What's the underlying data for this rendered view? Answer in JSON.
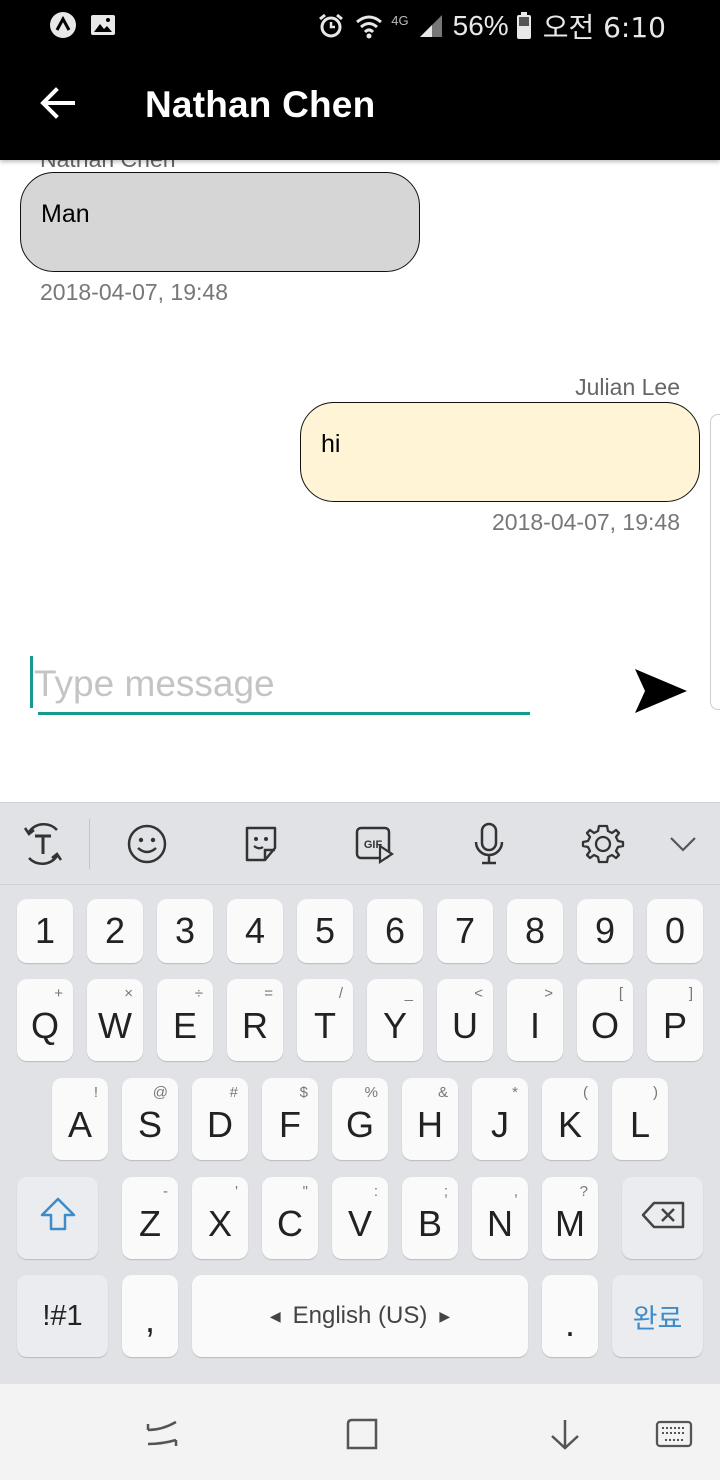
{
  "status_bar": {
    "battery": "56%",
    "time": "오전 6:10",
    "network": "4G",
    "icons": [
      "app-a-icon",
      "gallery-icon",
      "alarm-icon",
      "wifi-icon",
      "signal-icon",
      "battery-icon"
    ]
  },
  "app_bar": {
    "title": "Nathan Chen"
  },
  "messages": [
    {
      "sender": "Nathan Chen",
      "text": "Man",
      "time": "2018-04-07, 19:48",
      "side": "left",
      "bubble_color": "#d6d6d6"
    },
    {
      "sender": "Julian Lee",
      "text": "hi",
      "time": "2018-04-07, 19:48",
      "side": "right",
      "bubble_color": "#fff5d6"
    }
  ],
  "composer": {
    "placeholder": "Type message",
    "value": ""
  },
  "accent_color": "#159a90",
  "keyboard": {
    "toolbar_icons": [
      "translate-icon",
      "emoji-icon",
      "sticker-icon",
      "gif-icon",
      "microphone-icon",
      "settings-icon",
      "collapse-icon"
    ],
    "number_row": [
      "1",
      "2",
      "3",
      "4",
      "5",
      "6",
      "7",
      "8",
      "9",
      "0"
    ],
    "row1": [
      {
        "key": "Q",
        "hint": "+"
      },
      {
        "key": "W",
        "hint": "×"
      },
      {
        "key": "E",
        "hint": "÷"
      },
      {
        "key": "R",
        "hint": "="
      },
      {
        "key": "T",
        "hint": "/"
      },
      {
        "key": "Y",
        "hint": "_"
      },
      {
        "key": "U",
        "hint": "<"
      },
      {
        "key": "I",
        "hint": ">"
      },
      {
        "key": "O",
        "hint": "["
      },
      {
        "key": "P",
        "hint": "]"
      }
    ],
    "row2": [
      {
        "key": "A",
        "hint": "!"
      },
      {
        "key": "S",
        "hint": "@"
      },
      {
        "key": "D",
        "hint": "#"
      },
      {
        "key": "F",
        "hint": "$"
      },
      {
        "key": "G",
        "hint": "%"
      },
      {
        "key": "H",
        "hint": "&"
      },
      {
        "key": "J",
        "hint": "*"
      },
      {
        "key": "K",
        "hint": "("
      },
      {
        "key": "L",
        "hint": ")"
      }
    ],
    "row3": [
      {
        "key": "Z",
        "hint": "-"
      },
      {
        "key": "X",
        "hint": "'"
      },
      {
        "key": "C",
        "hint": "\""
      },
      {
        "key": "V",
        "hint": ":"
      },
      {
        "key": "B",
        "hint": ";"
      },
      {
        "key": "N",
        "hint": ","
      },
      {
        "key": "M",
        "hint": "?"
      }
    ],
    "symbols_label": "!#1",
    "comma": ",",
    "space_label": "English (US)",
    "period": ".",
    "done_label": "완료"
  },
  "nav_bar": {
    "icons": [
      "recents-icon",
      "home-icon",
      "hide-keyboard-icon",
      "keyboard-switch-icon"
    ]
  }
}
